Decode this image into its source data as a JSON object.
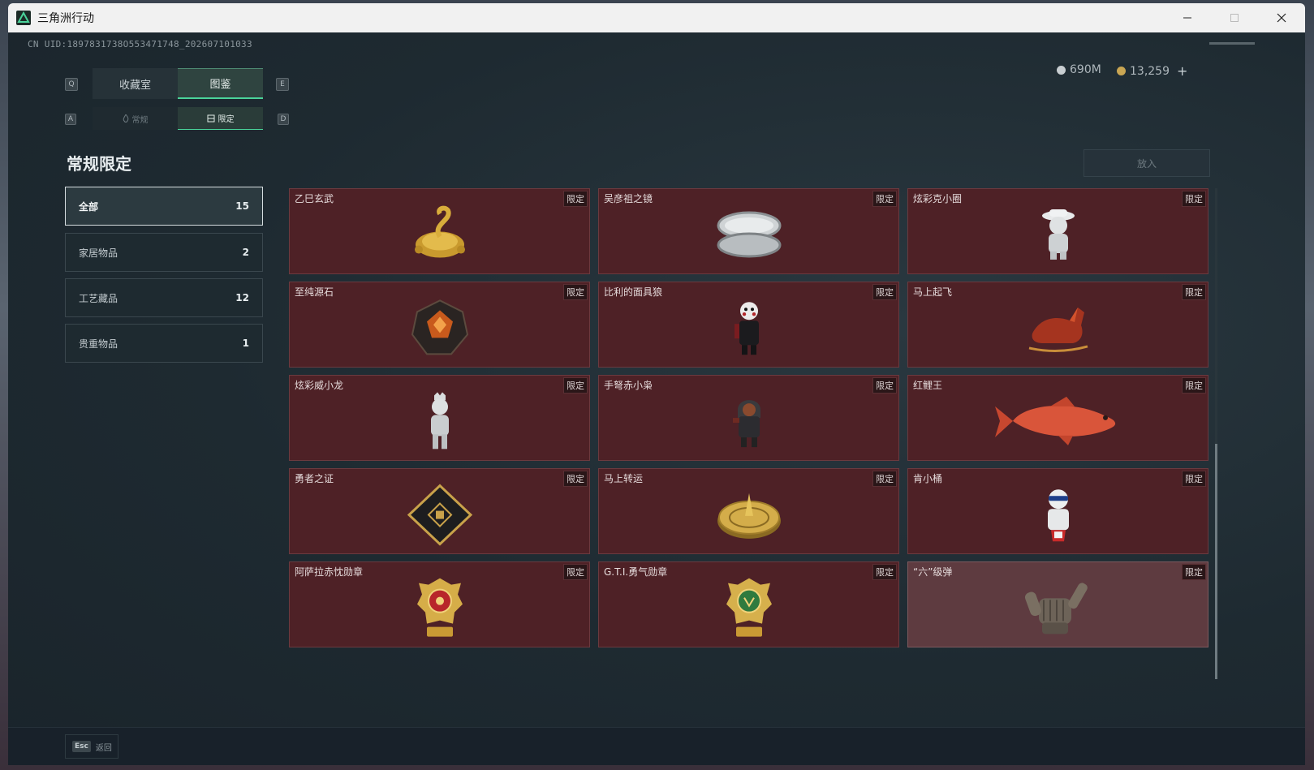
{
  "window": {
    "title": "三角洲行动"
  },
  "uid": "CN UID:1897831738O553471748_202607101033",
  "tabs": [
    {
      "label": "收藏室",
      "active": false
    },
    {
      "label": "图鉴",
      "active": true
    }
  ],
  "tab_keys": {
    "left": "Q",
    "right": "E"
  },
  "subtabs": [
    {
      "label": "常规",
      "icon": "flame-icon",
      "active": false
    },
    {
      "label": "限定",
      "icon": "box-icon",
      "active": true
    }
  ],
  "subtab_keys": {
    "left": "A",
    "right": "D"
  },
  "currency": {
    "silver": "690M",
    "gold": "13,259",
    "plus": "+"
  },
  "page_title": "常规限定",
  "put_button": "放入",
  "categories": [
    {
      "label": "全部",
      "count": "15",
      "active": true
    },
    {
      "label": "家居物品",
      "count": "2",
      "active": false
    },
    {
      "label": "工艺藏品",
      "count": "12",
      "active": false
    },
    {
      "label": "贵重物品",
      "count": "1",
      "active": false
    }
  ],
  "items": [
    {
      "name": "乙巳玄武",
      "badge": "限定",
      "icon": "golden-snake-turtle-icon"
    },
    {
      "name": "吴彦祖之镜",
      "badge": "限定",
      "icon": "silver-compact-mirror-icon"
    },
    {
      "name": "炫彩克小圈",
      "badge": "限定",
      "icon": "white-figurine-hat-icon"
    },
    {
      "name": "至纯源石",
      "badge": "限定",
      "icon": "glowing-crystal-icon"
    },
    {
      "name": "比利的面具狼",
      "badge": "限定",
      "icon": "billy-puppet-figure-icon"
    },
    {
      "name": "马上起飞",
      "badge": "限定",
      "icon": "red-horse-icon"
    },
    {
      "name": "炫彩威小龙",
      "badge": "限定",
      "icon": "white-figurine-icon"
    },
    {
      "name": "手弩赤小枭",
      "badge": "限定",
      "icon": "hooded-figure-icon"
    },
    {
      "name": "红鲤王",
      "badge": "限定",
      "icon": "red-carp-icon"
    },
    {
      "name": "勇者之证",
      "badge": "限定",
      "icon": "black-gold-card-icon"
    },
    {
      "name": "马上转运",
      "badge": "限定",
      "icon": "golden-disc-icon"
    },
    {
      "name": "肯小桶",
      "badge": "限定",
      "icon": "bucket-mascot-icon"
    },
    {
      "name": "阿萨拉赤忱勋章",
      "badge": "限定",
      "icon": "red-gold-medal-icon"
    },
    {
      "name": "G.T.I.勇气勋章",
      "badge": "限定",
      "icon": "green-gold-medal-icon"
    },
    {
      "name": "“六”级弹",
      "badge": "限定",
      "icon": "shaka-hand-icon"
    }
  ],
  "bottom": {
    "esc_key": "Esc",
    "back_label": "返回"
  },
  "colors": {
    "accent": "#4ad39a",
    "card_bg": "#4e2126",
    "card_bg_highlight": "#5e3b40"
  }
}
